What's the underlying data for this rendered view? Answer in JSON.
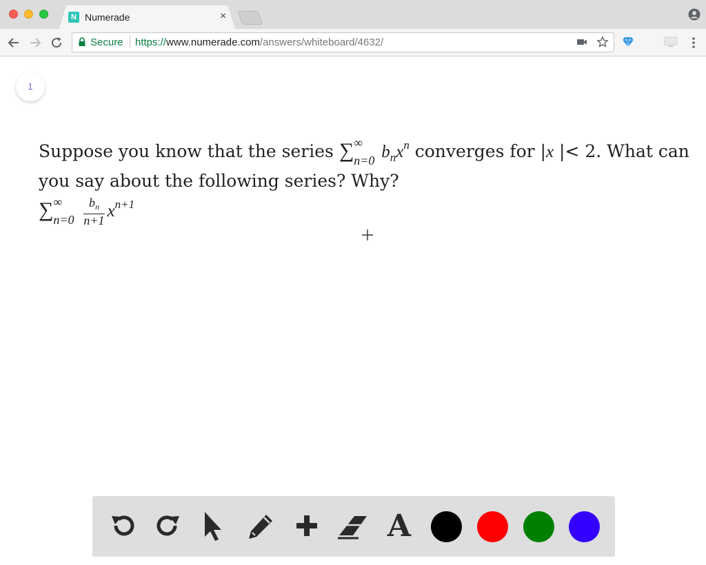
{
  "browser": {
    "tab_title": "Numerade",
    "tab_favicon_letter": "N",
    "tab_close": "×",
    "secure_label": "Secure",
    "url_scheme": "https://",
    "url_host": "www.numerade.com",
    "url_path": "/answers/whiteboard/4632/"
  },
  "whiteboard": {
    "page_number": "1",
    "question": {
      "line1_prefix": "Suppose you know that the series ",
      "sum_symbol": "∑",
      "sum_upper": "∞",
      "sum_lower": "n=0",
      "term1_base": "b",
      "term1_sub": "n",
      "term1_var": "x",
      "term1_sup": "n",
      "line1_mid": " converges for |",
      "abs_var": "x",
      "line1_suffix": " |< 2. What can",
      "line2": "you say about the following series? Why?",
      "frac_num_base": "b",
      "frac_num_sub": "n",
      "frac_den": "n+1",
      "term2_var": "x",
      "term2_sup": "n+1"
    }
  },
  "tools": {
    "items": [
      "undo-icon",
      "redo-icon",
      "pointer-icon",
      "pencil-icon",
      "plus-icon",
      "eraser-icon",
      "text-icon"
    ],
    "text_tool_glyph": "A",
    "colors": [
      "#000000",
      "#ff0000",
      "#008000",
      "#3300ff"
    ]
  }
}
